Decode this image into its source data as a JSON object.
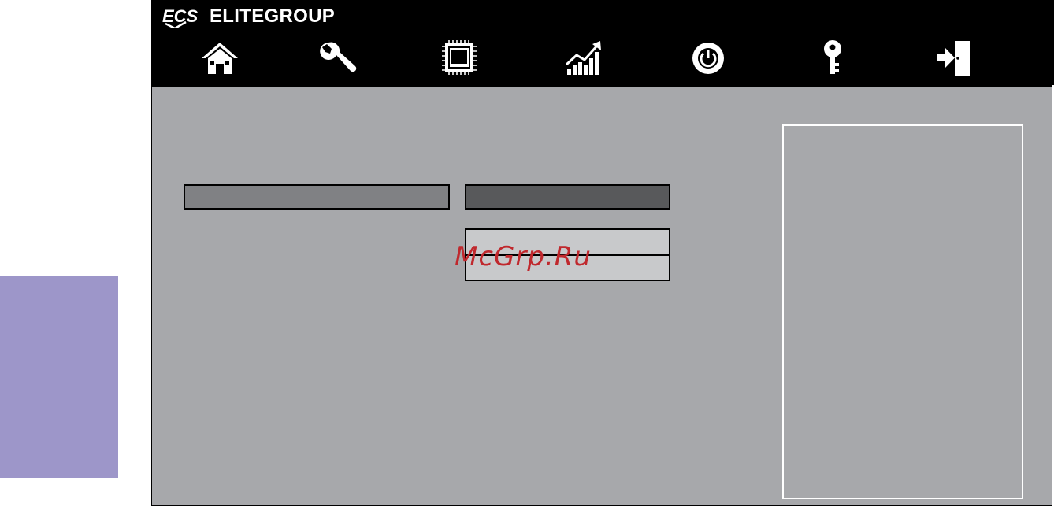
{
  "brand": {
    "logo_text": "ECS",
    "name": "ELITEGROUP"
  },
  "nav": {
    "items": [
      {
        "id": "main",
        "icon": "home-icon"
      },
      {
        "id": "advanced",
        "icon": "wrench-icon"
      },
      {
        "id": "chipset",
        "icon": "chip-icon"
      },
      {
        "id": "mi",
        "icon": "chart-icon"
      },
      {
        "id": "boot",
        "icon": "power-icon"
      },
      {
        "id": "security",
        "icon": "key-icon"
      },
      {
        "id": "exit",
        "icon": "exit-icon"
      }
    ]
  },
  "watermark": "McGrp.Ru",
  "colors": {
    "header_bg": "#000000",
    "panel_bg": "#a7a8ab",
    "side_tab": "#9d96c9",
    "label_box": "#808184",
    "value_box": "#58595b",
    "dropdown_bg": "#c8c9cb",
    "watermark": "#c0282d"
  }
}
